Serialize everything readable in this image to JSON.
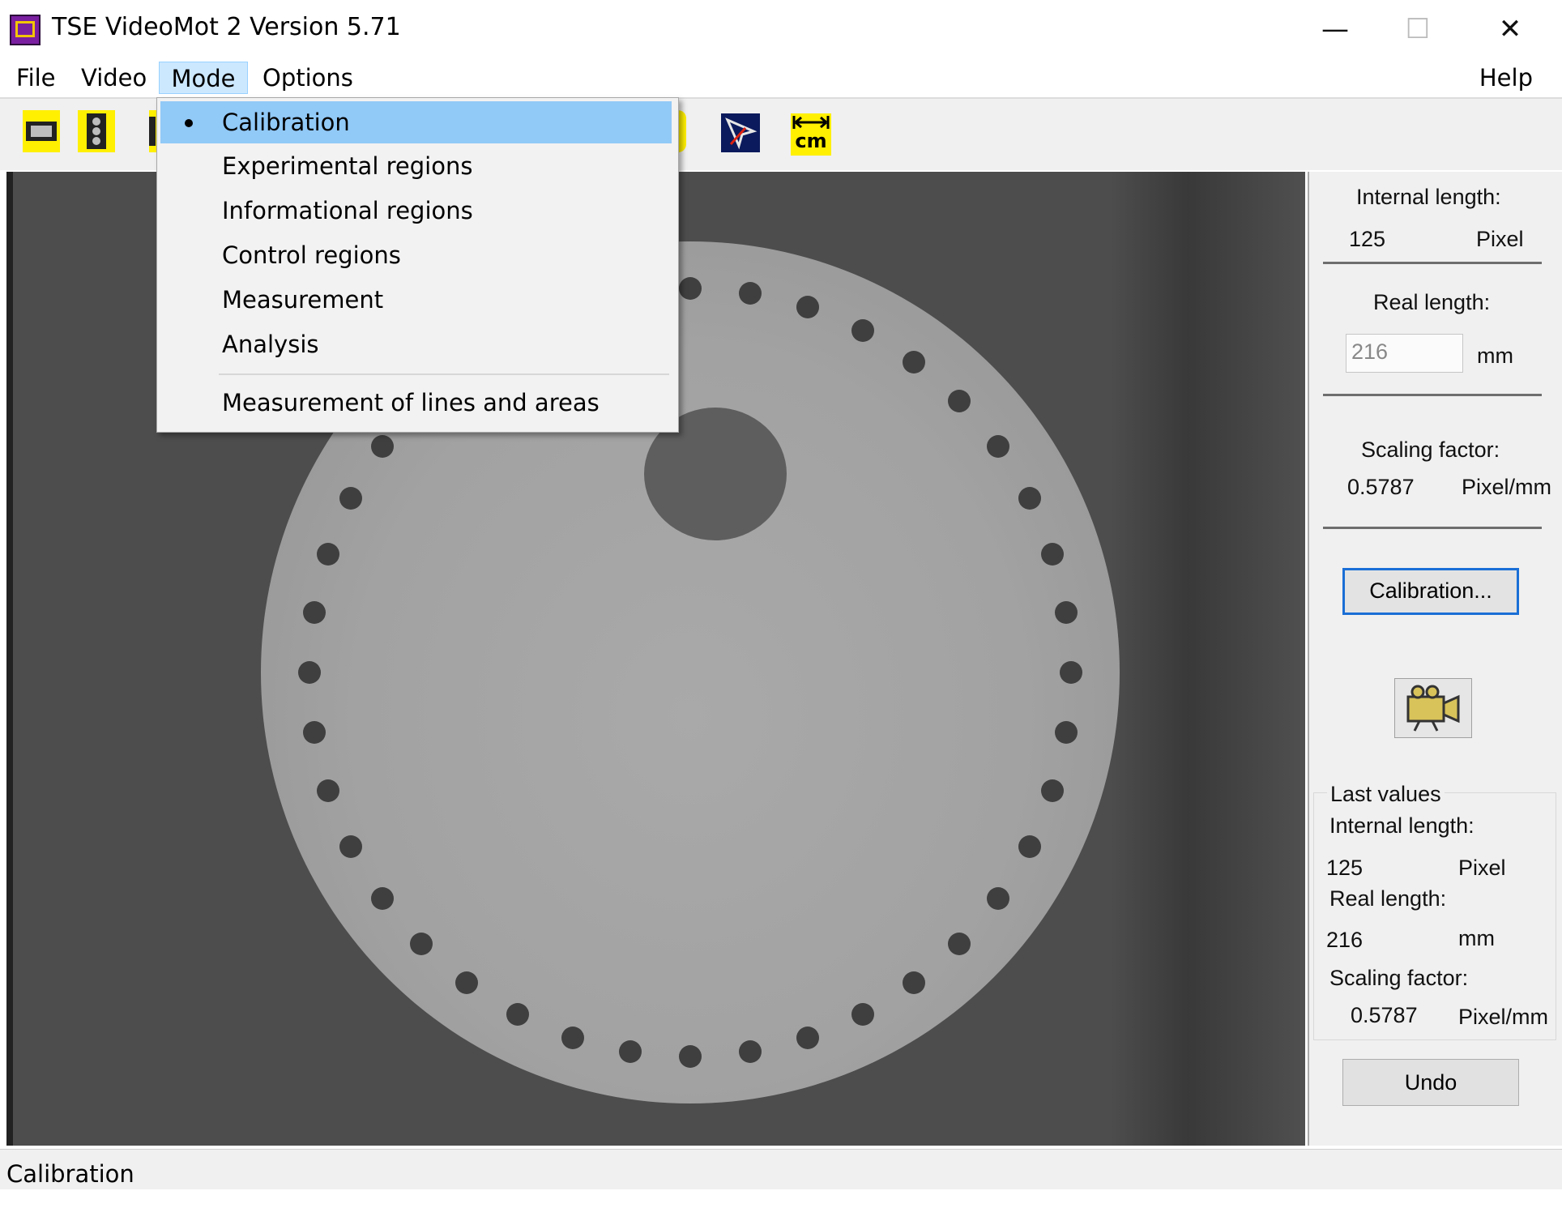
{
  "window": {
    "title": "TSE VideoMot 2 Version 5.71",
    "minimize_glyph": "—",
    "maximize_glyph": "☐",
    "close_glyph": "✕"
  },
  "menu": {
    "items": [
      "File",
      "Video",
      "Mode",
      "Options"
    ],
    "help": "Help",
    "active": "Mode"
  },
  "mode_menu": {
    "items": [
      "Calibration",
      "Experimental regions",
      "Informational regions",
      "Control regions",
      "Measurement",
      "Analysis",
      "Measurement of lines and areas"
    ],
    "checked": "Calibration"
  },
  "toolbar": {
    "icons": [
      "video-strip-icon",
      "traffic-light-icon",
      "strip-icon",
      "cursor-arrow-icon",
      "length-cm-icon"
    ],
    "cm_label": "cm",
    "accent": "#ffef00"
  },
  "panel": {
    "internal_length_label": "Internal length:",
    "internal_length_value": "125",
    "internal_length_unit": "Pixel",
    "real_length_label": "Real length:",
    "real_length_value": "216",
    "real_length_unit": "mm",
    "scaling_label": "Scaling factor:",
    "scaling_value": "0.5787",
    "scaling_unit": "Pixel/mm",
    "calibration_button": "Calibration...",
    "last_values": {
      "title": "Last values",
      "internal_length_label": "Internal length:",
      "internal_length_value": "125",
      "internal_length_unit": "Pixel",
      "real_length_label": "Real length:",
      "real_length_value": "216",
      "real_length_unit": "mm",
      "scaling_label": "Scaling factor:",
      "scaling_value": "0.5787",
      "scaling_unit": "Pixel/mm"
    },
    "undo_button": "Undo"
  },
  "status": {
    "text": "Calibration"
  },
  "colors": {
    "menu_highlight": "#91c9f7",
    "active_menu": "#cce8ff",
    "focus_border": "#1a6fd6",
    "app_icon": "#7a1fa0"
  }
}
